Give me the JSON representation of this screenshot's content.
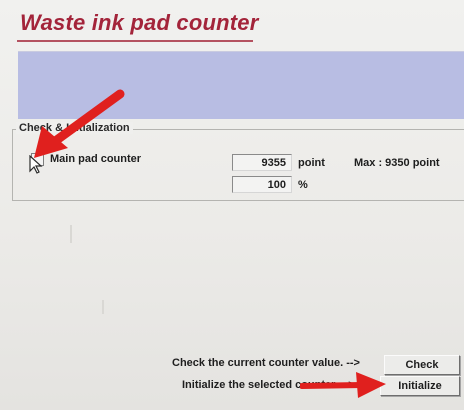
{
  "window": {
    "title": "Waste ink pad counter"
  },
  "group": {
    "label": "Check & Initialization"
  },
  "main_pad": {
    "label": "Main pad counter",
    "checked": false,
    "counter_value": "9355",
    "counter_unit": "point",
    "percent_value": "100",
    "percent_unit": "%",
    "max_label": "Max : 9350 point"
  },
  "actions": {
    "check_hint": "Check the current counter value. -->",
    "check_label": "Check",
    "initialize_hint": "Initialize the selected counter. -->",
    "initialize_label": "Initialize"
  },
  "colors": {
    "title": "#a3243a",
    "banner": "#b8bde3",
    "annotation_arrow": "#e0201e"
  },
  "icons": [
    "mouse-cursor-icon",
    "red-arrow-annotation"
  ]
}
